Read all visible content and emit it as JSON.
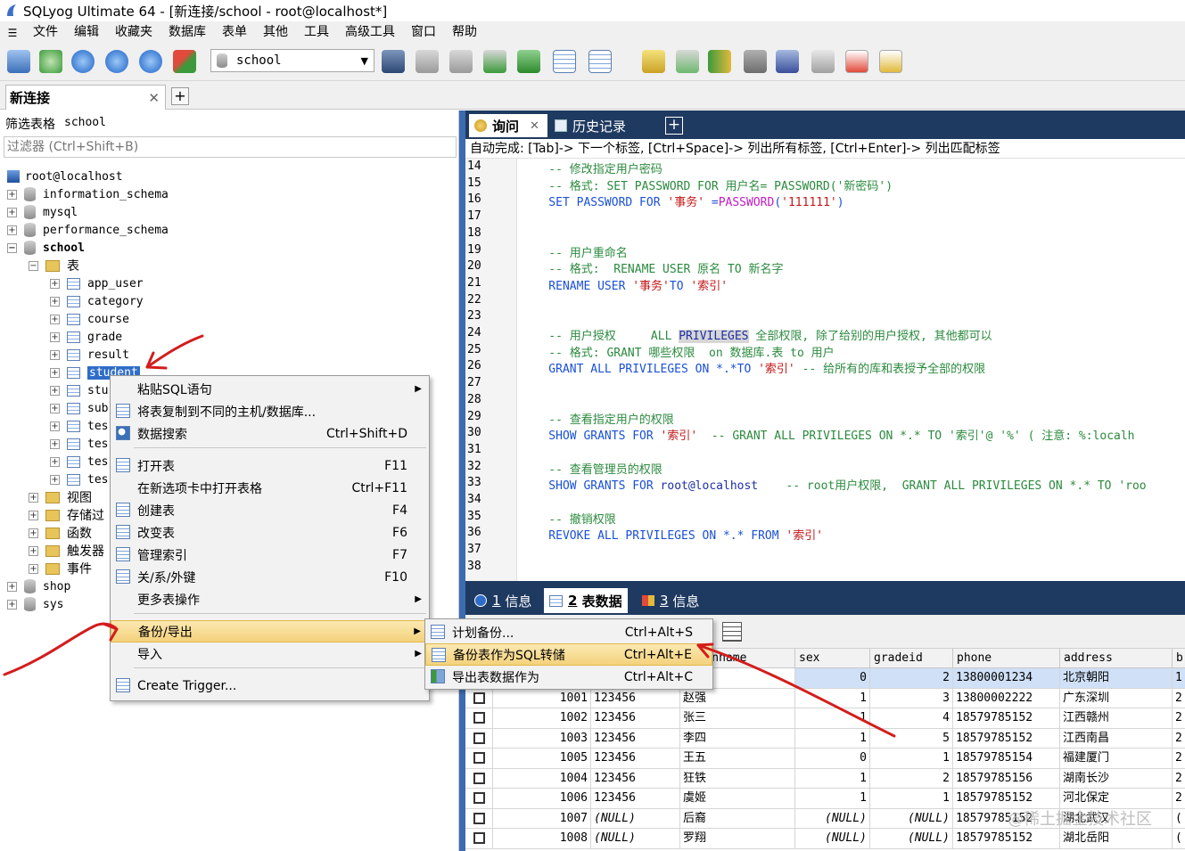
{
  "window": {
    "title": "SQLyog Ultimate 64 - [新连接/school - root@localhost*]"
  },
  "menubar": {
    "items": [
      "文件",
      "编辑",
      "收藏夹",
      "数据库",
      "表单",
      "其他",
      "工具",
      "高级工具",
      "窗口",
      "帮助"
    ]
  },
  "toolbar": {
    "db_selected": "school"
  },
  "conn_tab": {
    "label": "新连接"
  },
  "filter": {
    "label": "筛选表格",
    "value": "school",
    "placeholder": "过滤器 (Ctrl+Shift+B)"
  },
  "tree": {
    "root": "root@localhost",
    "databases": [
      "information_schema",
      "mysql",
      "performance_schema",
      "school"
    ],
    "school_folder_tables": "表",
    "tables": [
      "app_user",
      "category",
      "course",
      "grade",
      "result",
      "student",
      "stu",
      "sub",
      "tes",
      "tes",
      "tes",
      "tes"
    ],
    "folders": [
      "视图",
      "存储过",
      "函数",
      "触发器",
      "事件"
    ],
    "more_dbs": [
      "shop",
      "sys"
    ]
  },
  "query_tabs": {
    "query": "询问",
    "history": "历史记录"
  },
  "autocomplete": "自动完成: [Tab]-> 下一个标签, [Ctrl+Space]-> 列出所有标签, [Ctrl+Enter]-> 列出匹配标签",
  "editor": {
    "lines": [
      {
        "n": "14",
        "segs": [
          [
            "cm",
            "    -- 修改指定用户密码"
          ]
        ]
      },
      {
        "n": "15",
        "segs": [
          [
            "cm",
            "    -- 格式: SET PASSWORD FOR 用户名= PASSWORD('新密码')"
          ]
        ]
      },
      {
        "n": "16",
        "segs": [
          [
            "kw",
            "    SET PASSWORD FOR "
          ],
          [
            "str",
            "'事务'"
          ],
          [
            "kw",
            " ="
          ],
          [
            "fn",
            "PASSWORD"
          ],
          [
            "kw",
            "("
          ],
          [
            "str",
            "'111111'"
          ],
          [
            "kw",
            ")"
          ]
        ]
      },
      {
        "n": "17",
        "segs": []
      },
      {
        "n": "18",
        "segs": []
      },
      {
        "n": "19",
        "segs": [
          [
            "cm",
            "    -- 用户重命名"
          ]
        ]
      },
      {
        "n": "20",
        "segs": [
          [
            "cm",
            "    -- 格式:  RENAME USER 原名 TO 新名字"
          ]
        ]
      },
      {
        "n": "21",
        "segs": [
          [
            "kw",
            "    RENAME USER "
          ],
          [
            "str",
            "'事务'"
          ],
          [
            "kw",
            "TO "
          ],
          [
            "str",
            "'索引'"
          ]
        ]
      },
      {
        "n": "22",
        "segs": []
      },
      {
        "n": "23",
        "segs": []
      },
      {
        "n": "24",
        "segs": [
          [
            "cm",
            "    -- 用户授权     ALL "
          ],
          [
            "hl",
            "PRIVILEGES"
          ],
          [
            "cm",
            " 全部权限, 除了给别的用户授权, 其他都可以"
          ]
        ]
      },
      {
        "n": "25",
        "segs": [
          [
            "cm",
            "    -- 格式: GRANT 哪些权限  on 数据库.表 to 用户"
          ]
        ]
      },
      {
        "n": "26",
        "segs": [
          [
            "kw",
            "    GRANT ALL PRIVILEGES ON *.*TO "
          ],
          [
            "str",
            "'索引'"
          ],
          [
            "cm",
            " -- 给所有的库和表授予全部的权限"
          ]
        ]
      },
      {
        "n": "27",
        "segs": []
      },
      {
        "n": "28",
        "segs": []
      },
      {
        "n": "29",
        "segs": [
          [
            "cm",
            "    -- 查看指定用户的权限"
          ]
        ]
      },
      {
        "n": "30",
        "segs": [
          [
            "kw",
            "    SHOW GRANTS FOR "
          ],
          [
            "str",
            "'索引'"
          ],
          [
            "cm",
            "  -- GRANT ALL PRIVILEGES ON *.* TO '索引'@ '%' ( 注意: %:localh"
          ]
        ]
      },
      {
        "n": "31",
        "segs": []
      },
      {
        "n": "32",
        "segs": [
          [
            "cm",
            "    -- 查看管理员的权限"
          ]
        ]
      },
      {
        "n": "33",
        "segs": [
          [
            "kw",
            "    SHOW GRANTS FOR "
          ],
          [
            "",
            "root@localhost"
          ],
          [
            "cm",
            "    -- root用户权限,  GRANT ALL PRIVILEGES ON *.* TO 'roo"
          ]
        ]
      },
      {
        "n": "34",
        "segs": []
      },
      {
        "n": "35",
        "segs": [
          [
            "cm",
            "    -- 撤销权限"
          ]
        ]
      },
      {
        "n": "36",
        "segs": [
          [
            "kw",
            "    REVOKE ALL PRIVILEGES ON *.* FROM "
          ],
          [
            "str",
            "'索引'"
          ]
        ]
      },
      {
        "n": "37",
        "segs": []
      },
      {
        "n": "38",
        "segs": []
      }
    ]
  },
  "result_tabs": [
    {
      "num": "1",
      "label": "信息"
    },
    {
      "num": "2",
      "label": "表数据"
    },
    {
      "num": "3",
      "label": "信息"
    }
  ],
  "grid": {
    "headers": [
      "",
      "",
      "",
      "loginname",
      "sex",
      "gradeid",
      "phone",
      "address",
      "b"
    ],
    "rows": [
      [
        "",
        "",
        "",
        "",
        "0",
        "2",
        "13800001234",
        "北京朝阳",
        "1"
      ],
      [
        "",
        "1001",
        "123456",
        "赵强",
        "1",
        "3",
        "13800002222",
        "广东深圳",
        "2"
      ],
      [
        "",
        "1002",
        "123456",
        "张三",
        "1",
        "4",
        "18579785152",
        "江西赣州",
        "2"
      ],
      [
        "",
        "1003",
        "123456",
        "李四",
        "1",
        "5",
        "18579785152",
        "江西南昌",
        "2"
      ],
      [
        "",
        "1005",
        "123456",
        "王五",
        "0",
        "1",
        "18579785154",
        "福建厦门",
        "2"
      ],
      [
        "",
        "1004",
        "123456",
        "狂铁",
        "1",
        "2",
        "18579785156",
        "湖南长沙",
        "2"
      ],
      [
        "",
        "1006",
        "123456",
        "虞姬",
        "1",
        "1",
        "18579785152",
        "河北保定",
        "2"
      ],
      [
        "",
        "1007",
        "(NULL)",
        "后裔",
        "(NULL)",
        "(NULL)",
        "18579785152",
        "湖北武汉",
        "("
      ],
      [
        "",
        "1008",
        "(NULL)",
        "罗翔",
        "(NULL)",
        "(NULL)",
        "18579785152",
        "湖北岳阳",
        "("
      ]
    ]
  },
  "context_menu": {
    "items": [
      {
        "label": "粘贴SQL语句",
        "shortcut": "",
        "submenu": true
      },
      {
        "label": "将表复制到不同的主机/数据库...",
        "shortcut": "",
        "submenu": false
      },
      {
        "label": "数据搜索",
        "shortcut": "Ctrl+Shift+D",
        "submenu": false
      },
      {
        "label": "打开表",
        "shortcut": "F11",
        "submenu": false
      },
      {
        "label": "在新选项卡中打开表格",
        "shortcut": "Ctrl+F11",
        "submenu": false
      },
      {
        "label": "创建表",
        "shortcut": "F4",
        "submenu": false
      },
      {
        "label": "改变表",
        "shortcut": "F6",
        "submenu": false
      },
      {
        "label": "管理索引",
        "shortcut": "F7",
        "submenu": false
      },
      {
        "label": "关/系/外键",
        "shortcut": "F10",
        "submenu": false
      },
      {
        "label": "更多表操作",
        "shortcut": "",
        "submenu": true
      },
      {
        "label": "备份/导出",
        "shortcut": "",
        "submenu": true
      },
      {
        "label": "导入",
        "shortcut": "",
        "submenu": true
      },
      {
        "label": "Create Trigger...",
        "shortcut": "",
        "submenu": false
      }
    ]
  },
  "submenu": {
    "items": [
      {
        "label": "计划备份...",
        "shortcut": "Ctrl+Alt+S"
      },
      {
        "label": "备份表作为SQL转储",
        "shortcut": "Ctrl+Alt+E"
      },
      {
        "label": "导出表数据作为",
        "shortcut": "Ctrl+Alt+C"
      }
    ]
  },
  "watermark": "@稀土掘金技术社区",
  "colors": {
    "accent_blue": "#3c6bb0",
    "dark_tab": "#1f3a60",
    "comment": "#2b8a3e",
    "string": "#c21818",
    "keyword": "#1a50d8",
    "annotation_red": "#d41c1c"
  }
}
